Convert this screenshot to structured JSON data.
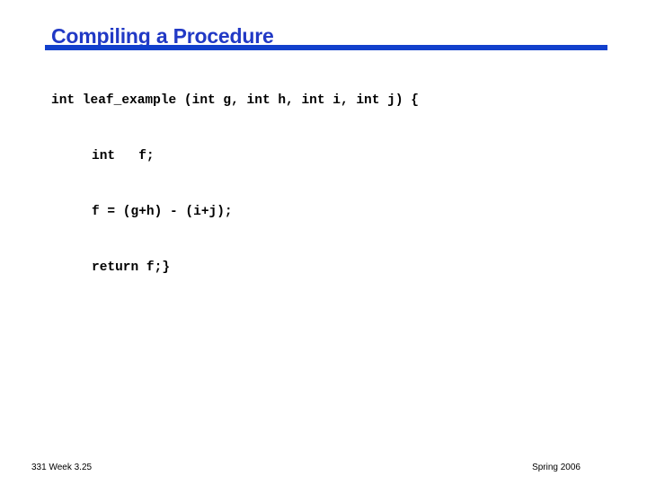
{
  "slide": {
    "title": "Compiling a Procedure",
    "accent_color": "#1240cc",
    "title_color": "#2139c5",
    "background_color": "#ffffff"
  },
  "code": {
    "language": "c",
    "lines": [
      {
        "text": "int leaf_example (int g, int h, int i, int j) {",
        "indent": false
      },
      {
        "text": "int   f;",
        "indent": true
      },
      {
        "text": "f = (g+h) - (i+j);",
        "indent": true
      },
      {
        "text": "return f;}",
        "indent": true
      }
    ]
  },
  "footer": {
    "left": "331 Week 3.25",
    "right": "Spring 2006"
  }
}
